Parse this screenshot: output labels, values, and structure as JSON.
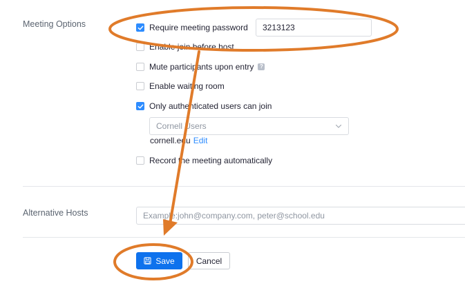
{
  "meeting_options": {
    "section_label": "Meeting Options",
    "options": [
      {
        "label": "Require meeting password",
        "checked": true
      },
      {
        "label": "Enable join before host",
        "checked": false
      },
      {
        "label": "Mute participants upon entry",
        "checked": false
      },
      {
        "label": "Enable waiting room",
        "checked": false
      },
      {
        "label": "Only authenticated users can join",
        "checked": true
      },
      {
        "label": "Record the meeting automatically",
        "checked": false
      }
    ],
    "password_value": "3213123",
    "auth_select_value": "Cornell Users",
    "auth_domain": "cornell.edu",
    "auth_edit_link": "Edit",
    "help_icon_glyph": "?"
  },
  "alternative_hosts": {
    "section_label": "Alternative Hosts",
    "placeholder": "Example:john@company.com, peter@school.edu"
  },
  "actions": {
    "save_label": "Save",
    "cancel_label": "Cancel"
  },
  "colors": {
    "accent": "#0e72ed",
    "checkbox_checked": "#2d8cff",
    "annotation": "#e07b2a"
  },
  "icons": {
    "save": "floppy-disk-icon",
    "select_chevron": "chevron-down-icon",
    "checkbox_check": "checkmark-icon",
    "help": "help-icon"
  }
}
